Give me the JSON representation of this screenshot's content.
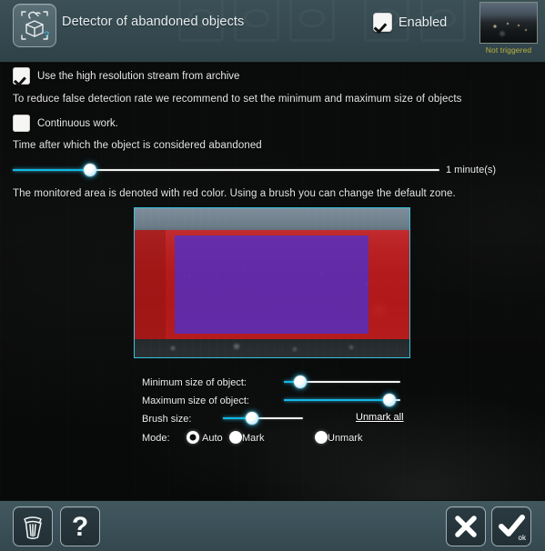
{
  "header": {
    "icon_name": "abandoned-object-detector-icon",
    "title": "Detector of abandoned objects",
    "enabled_label": "Enabled",
    "enabled_checked": true,
    "thumbnail_status": "Not triggered",
    "status_color": "#b9b43a",
    "bar_color": "#35484f"
  },
  "options": {
    "high_res_label": "Use the high resolution stream from archive",
    "high_res_checked": true,
    "hint_text": "To reduce false detection rate we recommend to set the minimum and maximum size of objects",
    "continuous_label": "Continuous work.",
    "continuous_checked": false,
    "time_label": "Time after which the object is considered abandoned",
    "time_value": "1 minute(s)",
    "zone_hint": "The monitored area is denoted with red color. Using a brush you can change the default zone."
  },
  "controls": {
    "min_size_label": "Minimum size of object:",
    "max_size_label": "Maximum size of object:",
    "brush_size_label": "Brush size:",
    "unmark_all_label": "Unmark all",
    "mode_label": "Mode:",
    "modes": [
      {
        "label": "Auto",
        "selected": true
      },
      {
        "label": "Mark",
        "selected": false
      },
      {
        "label": "Unmark",
        "selected": false
      }
    ]
  },
  "toolbar": {
    "delete_name": "trash-icon",
    "help_name": "question-mark-icon",
    "cancel_name": "close-icon",
    "ok_name": "checkmark-icon",
    "ok_sublabel": "ok"
  },
  "theme": {
    "accent": "#0fb8e8",
    "zone_red": "#de1818",
    "zone_blue": "#4830d8",
    "video_border": "#36c3dc"
  }
}
